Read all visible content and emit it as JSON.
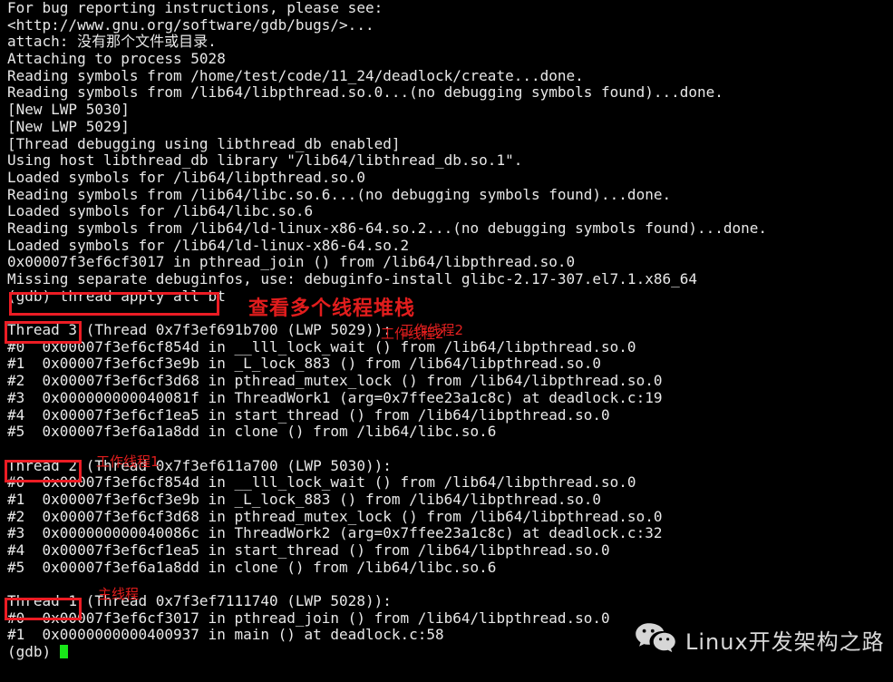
{
  "terminal": {
    "lines": [
      "For bug reporting instructions, please see:",
      "<http://www.gnu.org/software/gdb/bugs/>...",
      "attach: 没有那个文件或目录.",
      "Attaching to process 5028",
      "Reading symbols from /home/test/code/11_24/deadlock/create...done.",
      "Reading symbols from /lib64/libpthread.so.0...(no debugging symbols found)...done.",
      "[New LWP 5030]",
      "[New LWP 5029]",
      "[Thread debugging using libthread_db enabled]",
      "Using host libthread_db library \"/lib64/libthread_db.so.1\".",
      "Loaded symbols for /lib64/libpthread.so.0",
      "Reading symbols from /lib64/libc.so.6...(no debugging symbols found)...done.",
      "Loaded symbols for /lib64/libc.so.6",
      "Reading symbols from /lib64/ld-linux-x86-64.so.2...(no debugging symbols found)...done.",
      "Loaded symbols for /lib64/ld-linux-x86-64.so.2",
      "0x00007f3ef6cf3017 in pthread_join () from /lib64/libpthread.so.0",
      "Missing separate debuginfos, use: debuginfo-install glibc-2.17-307.el7.1.x86_64",
      "(gdb) thread apply all bt",
      "",
      "Thread 3 (Thread 0x7f3ef691b700 (LWP 5029)): ",
      "#0  0x00007f3ef6cf854d in __lll_lock_wait () from /lib64/libpthread.so.0",
      "#1  0x00007f3ef6cf3e9b in _L_lock_883 () from /lib64/libpthread.so.0",
      "#2  0x00007f3ef6cf3d68 in pthread_mutex_lock () from /lib64/libpthread.so.0",
      "#3  0x000000000040081f in ThreadWork1 (arg=0x7ffee23a1c8c) at deadlock.c:19",
      "#4  0x00007f3ef6cf1ea5 in start_thread () from /lib64/libpthread.so.0",
      "#5  0x00007f3ef6a1a8dd in clone () from /lib64/libc.so.6",
      "",
      "Thread 2 (Thread 0x7f3ef611a700 (LWP 5030)):",
      "#0  0x00007f3ef6cf854d in __lll_lock_wait () from /lib64/libpthread.so.0",
      "#1  0x00007f3ef6cf3e9b in _L_lock_883 () from /lib64/libpthread.so.0",
      "#2  0x00007f3ef6cf3d68 in pthread_mutex_lock () from /lib64/libpthread.so.0",
      "#3  0x000000000040086c in ThreadWork2 (arg=0x7ffee23a1c8c) at deadlock.c:32",
      "#4  0x00007f3ef6cf1ea5 in start_thread () from /lib64/libpthread.so.0",
      "#5  0x00007f3ef6a1a8dd in clone () from /lib64/libc.so.6",
      "",
      "Thread 1 (Thread 0x7f3ef7111740 (LWP 5028)):",
      "#0  0x00007f3ef6cf3017 in pthread_join () from /lib64/libpthread.so.0",
      "#1  0x0000000000400937 in main () at deadlock.c:58",
      "(gdb) "
    ],
    "thread3_inline_note": "工作线程2",
    "prompt": "(gdb) ",
    "command": "thread apply all bt"
  },
  "annotations": {
    "callout_multi_thread": "查看多个线程堆栈",
    "callout_worker_thread2": "工作线程2",
    "callout_worker_thread1": "工作线程1",
    "callout_main_thread": "主线程",
    "box_labels": {
      "command": "(gdb) thread apply all bt",
      "thread3": "Thread 3",
      "thread2": "Thread 2",
      "thread1": "Thread 1"
    },
    "color_red": "#ec1c24",
    "color_text": "#e8e8e8",
    "color_cursor": "#19e619"
  },
  "watermark": {
    "text": "Linux开发架构之路",
    "icon": "wechat-icon"
  }
}
